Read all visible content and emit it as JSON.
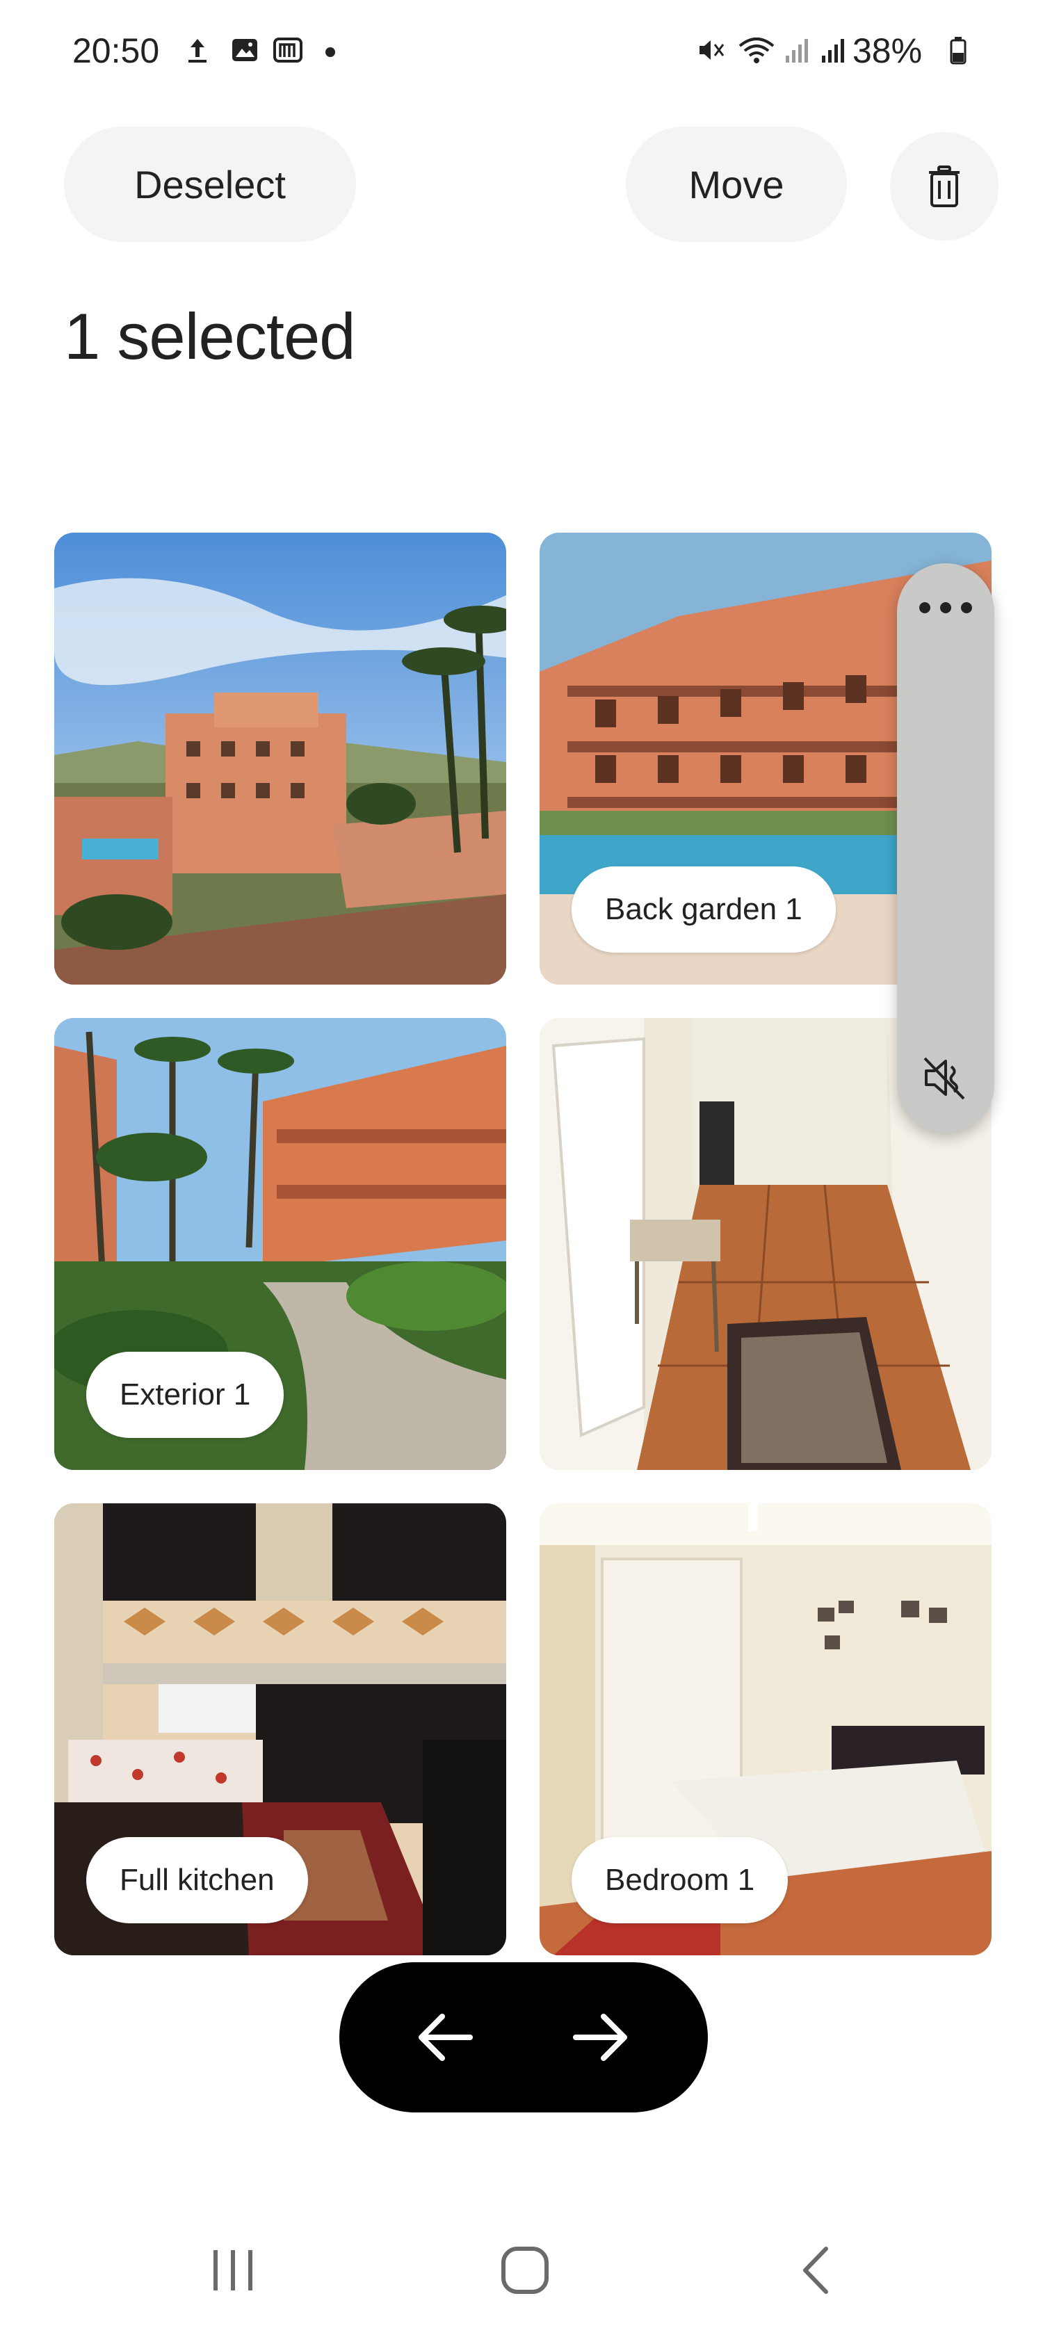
{
  "status_bar": {
    "time": "20:50",
    "battery_percent": "38%",
    "icons": [
      "upload-icon",
      "gallery-icon",
      "m-app-icon",
      "notification-dot",
      "mute-icon",
      "wifi-icon",
      "signal-icon",
      "signal-icon-2",
      "battery-icon"
    ]
  },
  "toolbar": {
    "deselect_label": "Deselect",
    "move_label": "Move",
    "delete_icon": "trash-icon"
  },
  "page": {
    "title": "1 selected"
  },
  "photos": [
    {
      "label": ""
    },
    {
      "label": "Back garden 1"
    },
    {
      "label": "Exterior 1"
    },
    {
      "label": ""
    },
    {
      "label": "Full kitchen"
    },
    {
      "label": "Bedroom 1"
    }
  ],
  "side_panel": {
    "more_icon": "more-horizontal-icon",
    "mute_icon": "sound-muted-icon"
  },
  "pager": {
    "prev_icon": "arrow-left-icon",
    "next_icon": "arrow-right-icon"
  },
  "nav_bar": {
    "icons": [
      "recents-icon",
      "home-icon",
      "back-icon"
    ]
  },
  "colors": {
    "accent": "#000000",
    "pill_bg": "#f4f4f4",
    "terracotta": "#d9805c",
    "pool": "#3fa6c9"
  }
}
